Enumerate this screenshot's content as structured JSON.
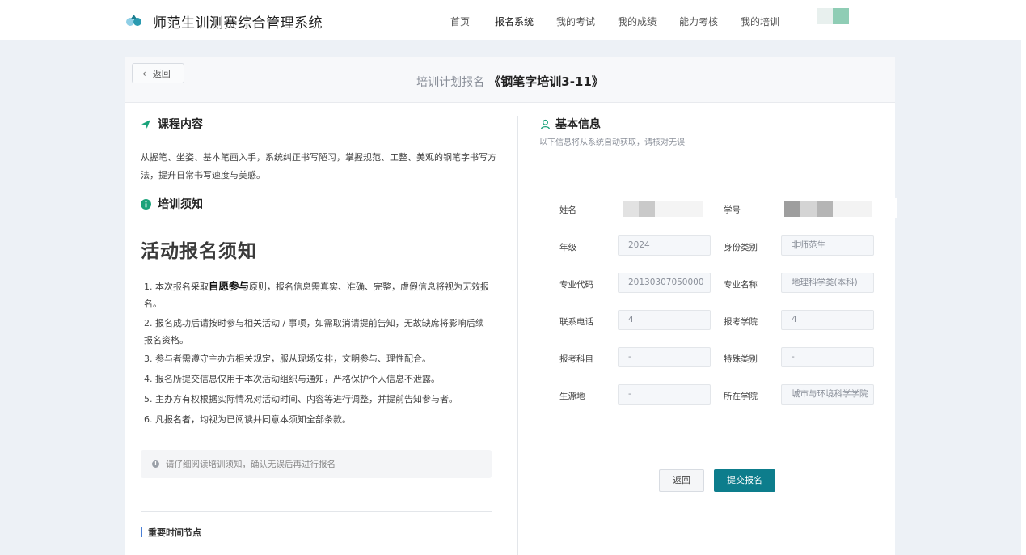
{
  "app": {
    "brand": "师范生训测赛综合管理系统"
  },
  "nav": {
    "items": [
      {
        "label": "首页"
      },
      {
        "label": "报名系统"
      },
      {
        "label": "我的考试"
      },
      {
        "label": "我的成绩"
      },
      {
        "label": "能力考核"
      },
      {
        "label": "我的培训"
      }
    ]
  },
  "header": {
    "back_label": "返回",
    "title_prefix": "培训计划报名",
    "course_title": "《钢笔字培训3-11》"
  },
  "course": {
    "heading": "课程内容",
    "description": "从握笔、坐姿、基本笔画入手，系统纠正书写陋习，掌握规范、工整、美观的钢笔字书写方法，提升日常书写速度与美感。"
  },
  "notice": {
    "heading": "培训须知",
    "big_title": "活动报名须知",
    "rule1_pre": "1. 本次报名采取",
    "rule1_bold": "自愿参与",
    "rule1_post": "原则，报名信息需真实、准确、完整，虚假信息将视为无效报名。",
    "rules": [
      "2. 报名成功后请按时参与相关活动 / 事项，如需取消请提前告知，无故缺席将影响后续报名资格。",
      "3. 参与者需遵守主办方相关规定，服从现场安排，文明参与、理性配合。",
      "4. 报名所提交信息仅用于本次活动组织与通知，严格保护个人信息不泄露。",
      "5. 主办方有权根据实际情况对活动时间、内容等进行调整，并提前告知参与者。",
      "6. 凡报名者，均视为已阅读并同意本须知全部条款。"
    ],
    "tip": "请仔细阅读培训须知，确认无误后再进行报名"
  },
  "timeline": {
    "heading": "重要时间节点"
  },
  "basic": {
    "heading": "基本信息",
    "subtitle": "以下信息将从系统自动获取，请核对无误",
    "fields": {
      "name_label": "姓名",
      "student_id_label": "学号",
      "grade_label": "年级",
      "grade_value": "2024",
      "identity_label": "身份类别",
      "identity_value": "非师范生",
      "major_code_label": "专业代码",
      "major_code_value": "20130307050000",
      "major_name_label": "专业名称",
      "major_name_value": "地理科学类(本科)",
      "phone_label": "联系电话",
      "phone_value": "4",
      "college_apply_label": "报考学院",
      "college_apply_value": "4",
      "subject_label": "报考科目",
      "subject_value": "-",
      "special_label": "特殊类别",
      "special_value": "-",
      "origin_label": "生源地",
      "origin_value": "-",
      "college_label": "所在学院",
      "college_value": "城市与环境科学学院"
    }
  },
  "actions": {
    "back_label": "返回",
    "submit_label": "提交报名"
  },
  "colors": {
    "accent": "#0d7d8c",
    "nav_avatar": "#8fcdb5",
    "notice_icon": "#1aa37a",
    "timeline_bar": "#4a7fd6"
  }
}
